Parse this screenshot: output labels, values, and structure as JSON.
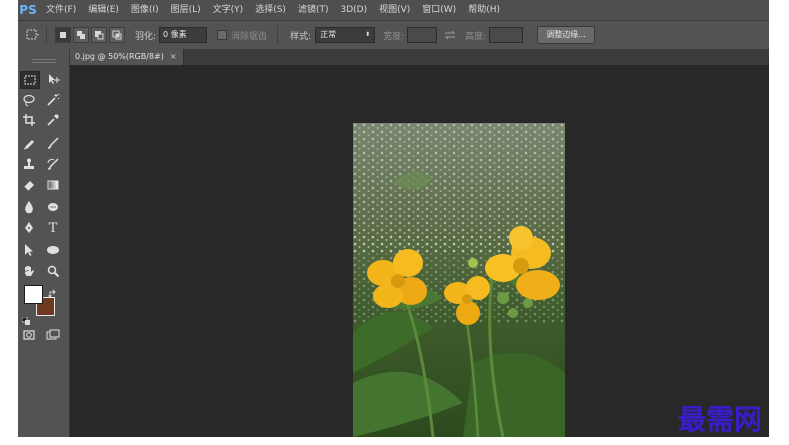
{
  "app": {
    "logo": "PS"
  },
  "menu": [
    "文件(F)",
    "编辑(E)",
    "图像(I)",
    "图层(L)",
    "文字(Y)",
    "选择(S)",
    "滤镜(T)",
    "3D(D)",
    "视图(V)",
    "窗口(W)",
    "帮助(H)"
  ],
  "options": {
    "feather_label": "羽化:",
    "feather_value": "0 像素",
    "antialias_label": "消除锯齿",
    "style_label": "样式:",
    "style_value": "正常",
    "width_label": "宽度:",
    "height_label": "高度:",
    "refine_edge_button": "调整边缘..."
  },
  "document": {
    "tab_title": "0.jpg @ 50%(RGB/8#)",
    "close": "×"
  },
  "colors": {
    "foreground": "#ffffff",
    "background": "#6b3a1f"
  },
  "icons": {
    "marquee": "rect-marquee-icon",
    "move": "move-icon",
    "lasso": "lasso-icon",
    "wand": "magic-wand-icon",
    "crop": "crop-icon",
    "eyedropper": "eyedropper-icon",
    "healing": "healing-brush-icon",
    "brush": "brush-icon",
    "stamp": "clone-stamp-icon",
    "history": "history-brush-icon",
    "eraser": "eraser-icon",
    "gradient": "gradient-icon",
    "blur": "blur-icon",
    "dodge": "dodge-icon",
    "pen": "pen-icon",
    "type": "type-icon",
    "path_select": "path-selection-icon",
    "shape": "ellipse-shape-icon",
    "hand": "hand-icon",
    "zoom": "zoom-icon",
    "quickmask": "quick-mask-icon",
    "screenmode": "screen-mode-icon"
  },
  "type_tool_glyph": "T",
  "watermark": "最需网"
}
